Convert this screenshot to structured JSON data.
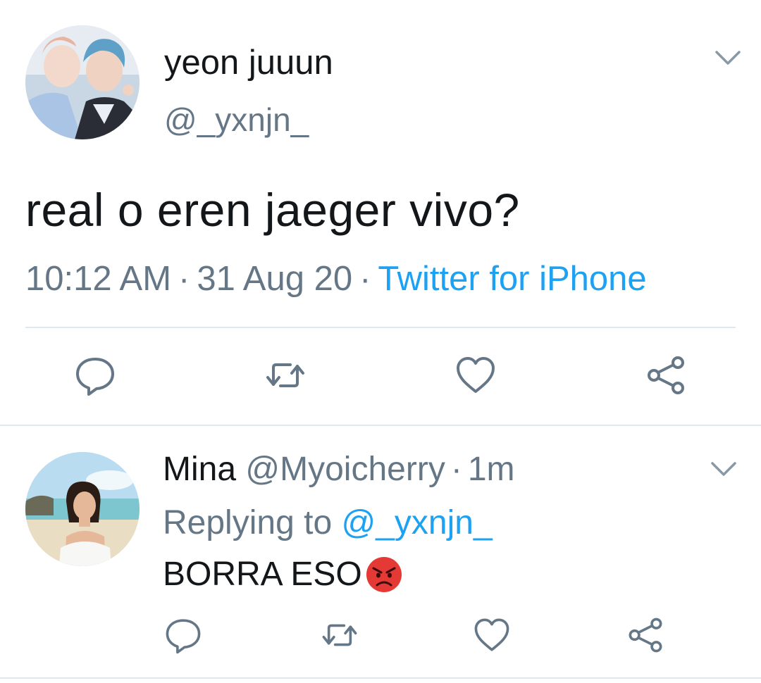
{
  "tweet": {
    "author_name": "yeon juuun",
    "author_handle": "@_yxnjn_",
    "text": "real o eren jaeger vivo?",
    "time": "10:12 AM",
    "date": "31 Aug 20",
    "separator": "·",
    "source": "Twitter for iPhone",
    "menu_icon": "chevron-down-icon"
  },
  "actions": {
    "reply_icon": "comment-icon",
    "retweet_icon": "retweet-icon",
    "like_icon": "heart-icon",
    "share_icon": "share-icon"
  },
  "reply": {
    "author_name": "Mina",
    "author_handle": "@Myoicherry",
    "separator": "·",
    "time_ago": "1m",
    "replying_prefix": "Replying to",
    "replying_handle": "@_yxnjn_",
    "text": "BORRA ESO",
    "emoji": "angry-face-emoji",
    "menu_icon": "chevron-down-icon"
  },
  "colors": {
    "text_primary": "#14171a",
    "text_secondary": "#657786",
    "link": "#1da1f2",
    "divider": "#e1e8ed"
  }
}
